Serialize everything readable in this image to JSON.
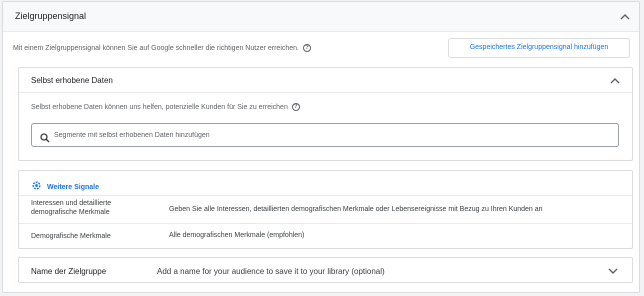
{
  "header": {
    "title": "Zielgruppensignal"
  },
  "intro": {
    "text": "Mit einem Zielgruppensignal können Sie auf Google schneller die richtigen Nutzer erreichen."
  },
  "save_button": {
    "label": "Gespeichertes Zielgruppensignal hinzufügen"
  },
  "first_party": {
    "title": "Selbst erhobene Daten",
    "description": "Selbst erhobene Daten können uns helfen, potenzielle Kunden für Sie zu erreichen",
    "search_placeholder": "Segmente mit selbst erhobenen Daten hinzufügen"
  },
  "more_signals": {
    "link": "Weitere Signale",
    "rows": [
      {
        "key": "Interessen und detaillierte demografische Merkmale",
        "value": "Geben Sie alle Interessen, detaillierten demografischen Merkmale oder Lebensereignisse mit Bezug zu Ihren Kunden an"
      },
      {
        "key": "Demografische Merkmale",
        "value": "Alle demografischen Merkmale (empfohlen)"
      }
    ]
  },
  "audience_name": {
    "label": "Name der Zielgruppe",
    "value": "Add a name for your audience to save it to your library (optional)"
  },
  "colors": {
    "accent": "#1a73e8",
    "border": "#dadce0",
    "text": "#3c4043"
  },
  "icons": [
    "chevron-up-icon",
    "help-icon",
    "search-icon",
    "gear-icon",
    "chevron-down-icon"
  ]
}
